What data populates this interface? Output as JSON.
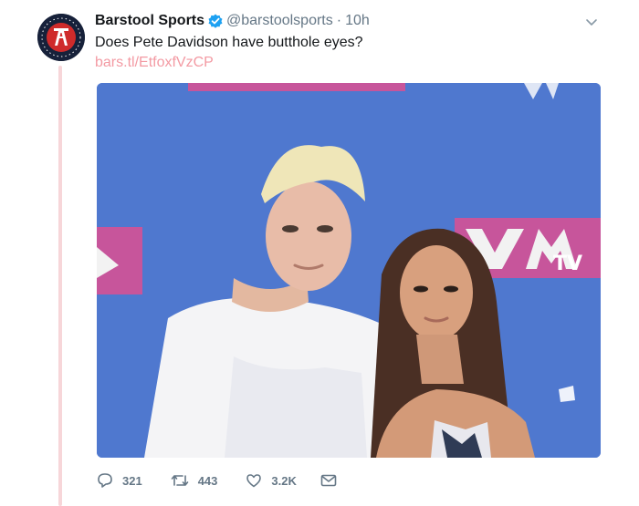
{
  "tweet": {
    "display_name": "Barstool Sports",
    "handle": "@barstoolsports",
    "separator": "·",
    "time": "10h",
    "text": "Does Pete Davidson have butthole eyes?",
    "link": "bars.tl/EtfoxfVzCP"
  },
  "actions": {
    "replies": "321",
    "retweets": "443",
    "likes": "3.2K"
  },
  "media": {
    "backdrop_text": "VMA MTV"
  },
  "colors": {
    "accent_link": "#f39aa3",
    "thread_line": "#f7d6d9",
    "muted": "#657786",
    "verified": "#1da1f2",
    "backdrop_blue": "#4f78cf",
    "logo_pink": "#c7559b"
  },
  "icons": {
    "verified": "verified-badge-icon",
    "chevron": "chevron-down-icon",
    "reply": "reply-icon",
    "retweet": "retweet-icon",
    "like": "heart-icon",
    "dm": "envelope-icon"
  }
}
